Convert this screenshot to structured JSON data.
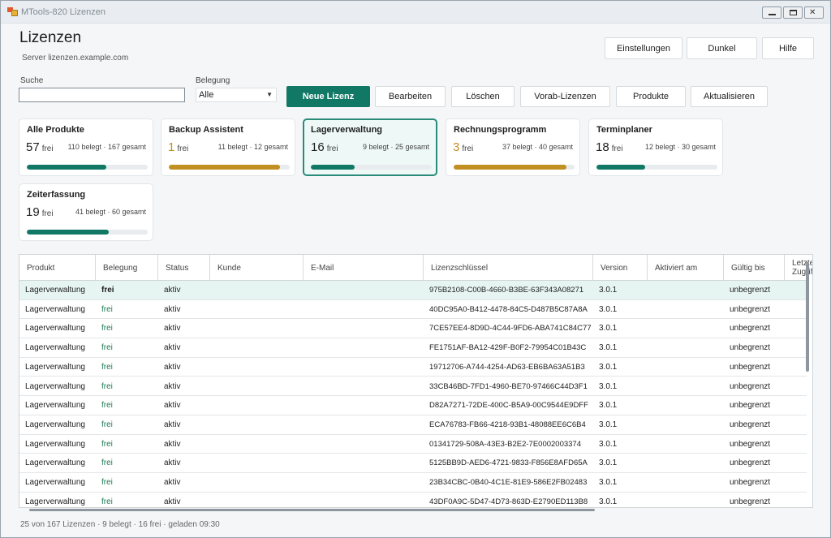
{
  "window": {
    "title": "MTools-820 Lizenzen"
  },
  "header": {
    "title": "Lizenzen",
    "server": "Server lizenzen.example.com",
    "buttons": {
      "settings": "Einstellungen",
      "dark": "Dunkel",
      "help": "Hilfe"
    }
  },
  "filters": {
    "search_label": "Suche",
    "search_value": "",
    "search_placeholder": "",
    "belegung_label": "Belegung",
    "belegung_value": "Alle"
  },
  "actions": {
    "new": "Neue Lizenz",
    "edit": "Bearbeiten",
    "delete": "Löschen",
    "pre": "Vorab-Lizenzen",
    "products": "Produkte",
    "refresh": "Aktualisieren"
  },
  "free_label": "frei",
  "cards": [
    {
      "name": "Alle Produkte",
      "free": "57",
      "meta": "110 belegt · 167 gesamt",
      "fill": 0.66,
      "color": "#117866"
    },
    {
      "name": "Backup Assistent",
      "free": "1",
      "meta": "11 belegt · 12 gesamt",
      "fill": 0.92,
      "color": "#c18f22"
    },
    {
      "name": "Lagerverwaltung",
      "free": "16",
      "meta": "9 belegt · 25 gesamt",
      "fill": 0.36,
      "color": "#117866"
    },
    {
      "name": "Rechnungsprogramm",
      "free": "3",
      "meta": "37 belegt · 40 gesamt",
      "fill": 0.93,
      "color": "#c18f22"
    },
    {
      "name": "Terminplaner",
      "free": "18",
      "meta": "12 belegt · 30 gesamt",
      "fill": 0.4,
      "color": "#117866"
    },
    {
      "name": "Zeiterfassung",
      "free": "19",
      "meta": "41 belegt · 60 gesamt",
      "fill": 0.68,
      "color": "#117866"
    }
  ],
  "table": {
    "columns": [
      "Produkt",
      "Belegung",
      "Status",
      "Kunde",
      "E-Mail",
      "Lizenzschlüssel",
      "Version",
      "Aktiviert am",
      "Gültig bis",
      "Letzter Zugriff"
    ],
    "rows": [
      {
        "produkt": "Lagerverwaltung",
        "belegung": "frei",
        "status": "aktiv",
        "kunde": "",
        "email": "",
        "key": "975B2108-C00B-4660-B3BE-63F343A08271",
        "version": "3.0.1",
        "aktiviert": "",
        "gueltig": "unbegrenzt"
      },
      {
        "produkt": "Lagerverwaltung",
        "belegung": "frei",
        "status": "aktiv",
        "kunde": "",
        "email": "",
        "key": "40DC95A0-B412-4478-84C5-D487B5C87A8A",
        "version": "3.0.1",
        "aktiviert": "",
        "gueltig": "unbegrenzt"
      },
      {
        "produkt": "Lagerverwaltung",
        "belegung": "frei",
        "status": "aktiv",
        "kunde": "",
        "email": "",
        "key": "7CE57EE4-8D9D-4C44-9FD6-ABA741C84C77",
        "version": "3.0.1",
        "aktiviert": "",
        "gueltig": "unbegrenzt"
      },
      {
        "produkt": "Lagerverwaltung",
        "belegung": "frei",
        "status": "aktiv",
        "kunde": "",
        "email": "",
        "key": "FE1751AF-BA12-429F-B0F2-79954C01B43C",
        "version": "3.0.1",
        "aktiviert": "",
        "gueltig": "unbegrenzt"
      },
      {
        "produkt": "Lagerverwaltung",
        "belegung": "frei",
        "status": "aktiv",
        "kunde": "",
        "email": "",
        "key": "19712706-A744-4254-AD63-EB6BA63A51B3",
        "version": "3.0.1",
        "aktiviert": "",
        "gueltig": "unbegrenzt"
      },
      {
        "produkt": "Lagerverwaltung",
        "belegung": "frei",
        "status": "aktiv",
        "kunde": "",
        "email": "",
        "key": "33CB46BD-7FD1-4960-BE70-97466C44D3F1",
        "version": "3.0.1",
        "aktiviert": "",
        "gueltig": "unbegrenzt"
      },
      {
        "produkt": "Lagerverwaltung",
        "belegung": "frei",
        "status": "aktiv",
        "kunde": "",
        "email": "",
        "key": "D82A7271-72DE-400C-B5A9-00C9544E9DFF",
        "version": "3.0.1",
        "aktiviert": "",
        "gueltig": "unbegrenzt"
      },
      {
        "produkt": "Lagerverwaltung",
        "belegung": "frei",
        "status": "aktiv",
        "kunde": "",
        "email": "",
        "key": "ECA76783-FB66-4218-93B1-48088EE6C6B4",
        "version": "3.0.1",
        "aktiviert": "",
        "gueltig": "unbegrenzt"
      },
      {
        "produkt": "Lagerverwaltung",
        "belegung": "frei",
        "status": "aktiv",
        "kunde": "",
        "email": "",
        "key": "01341729-508A-43E3-B2E2-7E0002003374",
        "version": "3.0.1",
        "aktiviert": "",
        "gueltig": "unbegrenzt"
      },
      {
        "produkt": "Lagerverwaltung",
        "belegung": "frei",
        "status": "aktiv",
        "kunde": "",
        "email": "",
        "key": "5125BB9D-AED6-4721-9833-F856E8AFD65A",
        "version": "3.0.1",
        "aktiviert": "",
        "gueltig": "unbegrenzt"
      },
      {
        "produkt": "Lagerverwaltung",
        "belegung": "frei",
        "status": "aktiv",
        "kunde": "",
        "email": "",
        "key": "23B34CBC-0B40-4C1E-81E9-586E2FB02483",
        "version": "3.0.1",
        "aktiviert": "",
        "gueltig": "unbegrenzt"
      },
      {
        "produkt": "Lagerverwaltung",
        "belegung": "frei",
        "status": "aktiv",
        "kunde": "",
        "email": "",
        "key": "43DF0A9C-5D47-4D73-863D-E2790ED113B8",
        "version": "3.0.1",
        "aktiviert": "",
        "gueltig": "unbegrenzt"
      }
    ]
  },
  "status_bar": "25 von 167 Lizenzen · 9 belegt · 16 frei · geladen 09:30"
}
